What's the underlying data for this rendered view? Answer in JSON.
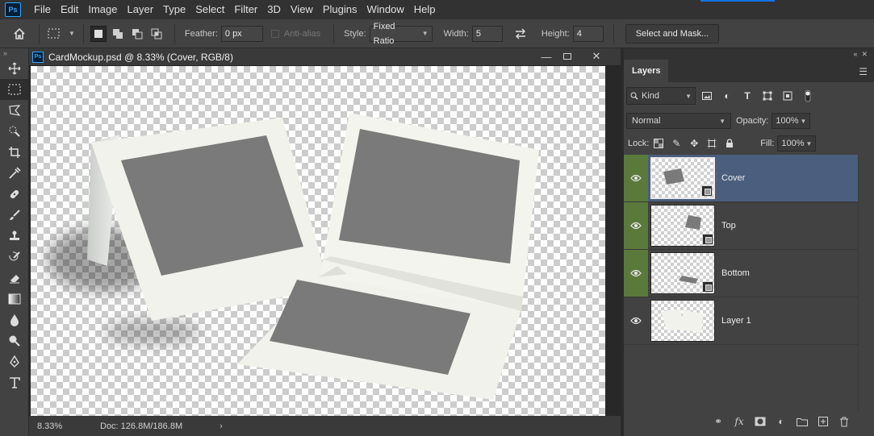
{
  "app": {
    "logo": "Ps"
  },
  "menu": [
    "File",
    "Edit",
    "Image",
    "Layer",
    "Type",
    "Select",
    "Filter",
    "3D",
    "View",
    "Plugins",
    "Window",
    "Help"
  ],
  "options": {
    "feather_label": "Feather:",
    "feather_value": "0 px",
    "antialias_label": "Anti-alias",
    "style_label": "Style:",
    "style_value": "Fixed Ratio",
    "width_label": "Width:",
    "width_value": "5",
    "height_label": "Height:",
    "height_value": "4",
    "select_mask_button": "Select and Mask..."
  },
  "document": {
    "tab_icon": "Ps",
    "title": "CardMockup.psd @ 8.33% (Cover, RGB/8)",
    "zoom": "8.33%",
    "doc_info": "Doc: 126.8M/186.8M"
  },
  "layers_panel": {
    "tab": "Layers",
    "filter_kind": "Kind",
    "blend_mode": "Normal",
    "opacity_label": "Opacity:",
    "opacity_value": "100%",
    "lock_label": "Lock:",
    "fill_label": "Fill:",
    "fill_value": "100%",
    "layers": [
      {
        "name": "Cover",
        "selected": true,
        "smart_object": true
      },
      {
        "name": "Top",
        "selected": false,
        "smart_object": true
      },
      {
        "name": "Bottom",
        "selected": false,
        "smart_object": true
      },
      {
        "name": "Layer 1",
        "selected": false,
        "smart_object": false
      }
    ]
  },
  "colors": {
    "selection_blue": "#4b5e7e",
    "visibility_green": "#5a7a3c",
    "card_paper": "#f2f2ec",
    "card_placeholder": "#7a7a7a"
  }
}
